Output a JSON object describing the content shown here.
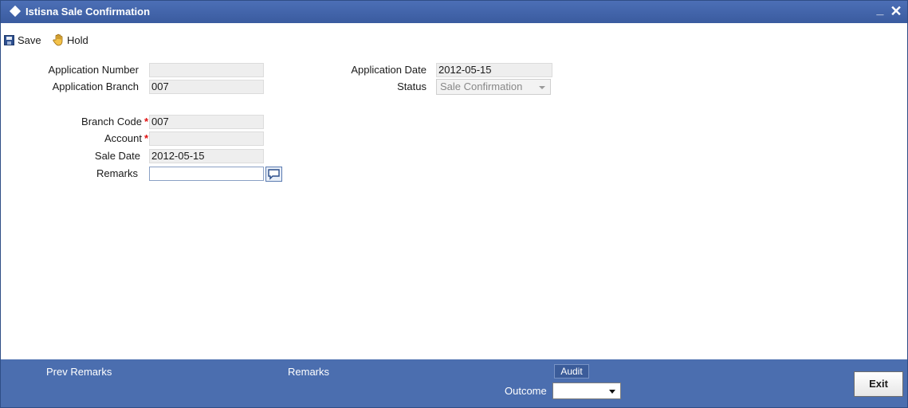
{
  "window": {
    "title": "Istisna Sale Confirmation",
    "minimize_label": "_",
    "close_label": "✕"
  },
  "toolbar": {
    "save_label": "Save",
    "hold_label": "Hold"
  },
  "form": {
    "application_number": {
      "label": "Application Number",
      "value": ""
    },
    "application_branch": {
      "label": "Application Branch",
      "value": "007"
    },
    "application_date": {
      "label": "Application Date",
      "value": "2012-05-15"
    },
    "status": {
      "label": "Status",
      "value": "Sale Confirmation"
    },
    "branch_code": {
      "label": "Branch Code",
      "required_mark": "*",
      "value": "007"
    },
    "account": {
      "label": "Account",
      "required_mark": "*",
      "value": ""
    },
    "sale_date": {
      "label": "Sale Date",
      "value": "2012-05-15"
    },
    "remarks": {
      "label": "Remarks",
      "value": ""
    }
  },
  "footer": {
    "prev_remarks_label": "Prev Remarks",
    "remarks_label": "Remarks",
    "audit_label": "Audit",
    "outcome_label": "Outcome",
    "outcome_value": "",
    "exit_label": "Exit"
  },
  "icons": {
    "title": "diamond-icon",
    "save": "save-icon",
    "hold": "hand-icon",
    "remarks": "comment-icon"
  },
  "colors": {
    "titlebar": "#3f62a8",
    "footer": "#4b6eaf",
    "required": "#e01010"
  }
}
